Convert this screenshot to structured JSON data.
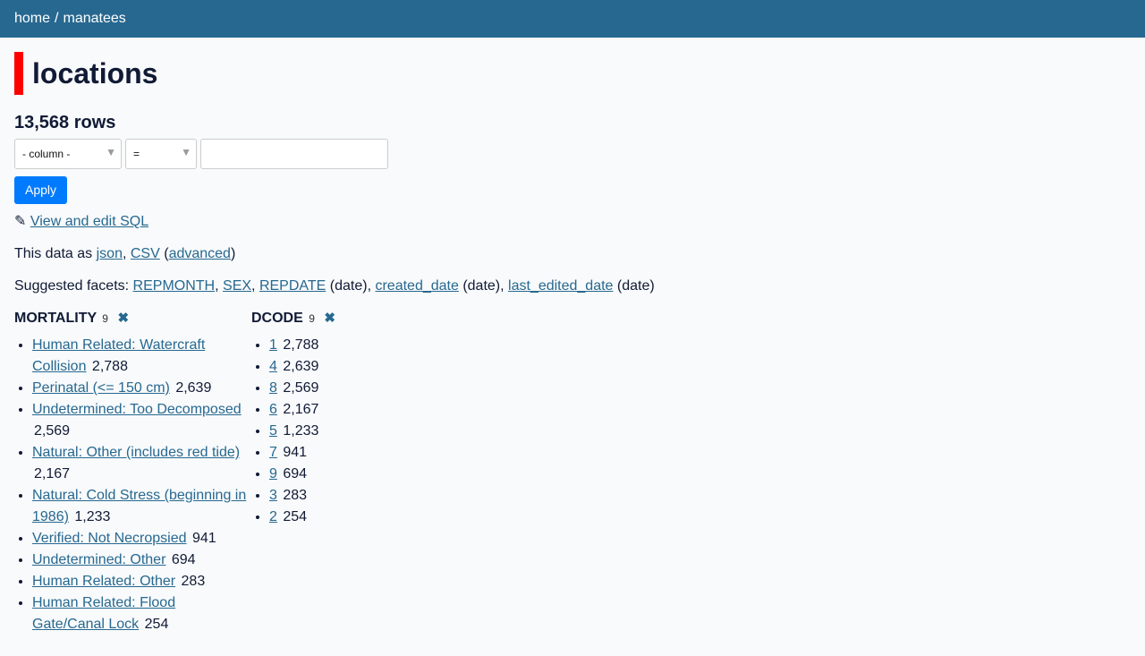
{
  "breadcrumb": {
    "home": "home",
    "separator": "/",
    "db": "manatees"
  },
  "page_title": "locations",
  "row_count": "13,568 rows",
  "filter": {
    "column_label": "- column -",
    "operator": "=",
    "value": "",
    "apply_label": "Apply"
  },
  "sql": {
    "icon": "✎",
    "link": "View and edit SQL"
  },
  "export": {
    "prefix": "This data as",
    "json": "json",
    "comma": ",",
    "csv": "CSV",
    "open_paren": "(",
    "advanced": "advanced",
    "close_paren": ")"
  },
  "suggested": {
    "prefix": "Suggested facets:",
    "items": [
      {
        "name": "REPMONTH",
        "suffix": ","
      },
      {
        "name": "SEX",
        "suffix": ","
      },
      {
        "name": "REPDATE",
        "suffix": " (date),"
      },
      {
        "name": "created_date",
        "suffix": " (date),"
      },
      {
        "name": "last_edited_date",
        "suffix": " (date)"
      }
    ]
  },
  "facets": [
    {
      "name": "MORTALITY",
      "count": "9",
      "remove_icon": "✖",
      "items": [
        {
          "label": "Human Related: Watercraft Collision",
          "count": "2,788"
        },
        {
          "label": "Perinatal (<= 150 cm)",
          "count": "2,639"
        },
        {
          "label": "Undetermined: Too Decomposed",
          "count": "2,569"
        },
        {
          "label": "Natural: Other (includes red tide)",
          "count": "2,167"
        },
        {
          "label": "Natural: Cold Stress (beginning in 1986)",
          "count": "1,233"
        },
        {
          "label": "Verified: Not Necropsied",
          "count": "941"
        },
        {
          "label": "Undetermined: Other",
          "count": "694"
        },
        {
          "label": "Human Related: Other",
          "count": "283"
        },
        {
          "label": "Human Related: Flood Gate/Canal Lock",
          "count": "254"
        }
      ]
    },
    {
      "name": "DCODE",
      "count": "9",
      "remove_icon": "✖",
      "items": [
        {
          "label": "1",
          "count": "2,788"
        },
        {
          "label": "4",
          "count": "2,639"
        },
        {
          "label": "8",
          "count": "2,569"
        },
        {
          "label": "6",
          "count": "2,167"
        },
        {
          "label": "5",
          "count": "1,233"
        },
        {
          "label": "7",
          "count": "941"
        },
        {
          "label": "9",
          "count": "694"
        },
        {
          "label": "3",
          "count": "283"
        },
        {
          "label": "2",
          "count": "254"
        }
      ]
    }
  ]
}
